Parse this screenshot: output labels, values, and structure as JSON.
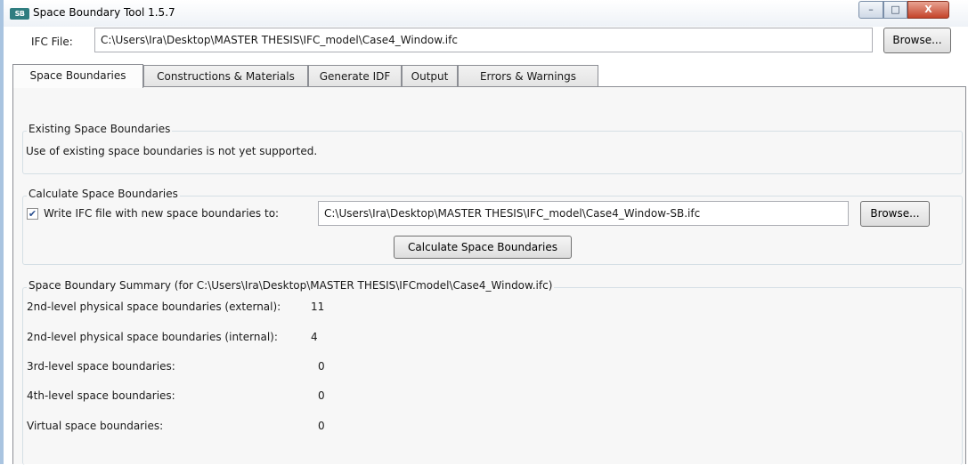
{
  "window": {
    "logo_text": "SB",
    "title": "Space Boundary Tool 1.5.7",
    "controls": {
      "minimize": "–",
      "maximize": "□",
      "close": "X"
    }
  },
  "file_row": {
    "label": "IFC File:",
    "path": "C:\\Users\\Ira\\Desktop\\MASTER THESIS\\IFC_model\\Case4_Window.ifc",
    "browse_label": "Browse..."
  },
  "tabs": [
    {
      "label": "Space Boundaries",
      "active": true
    },
    {
      "label": "Constructions & Materials",
      "active": false
    },
    {
      "label": "Generate IDF",
      "active": false
    },
    {
      "label": "Output",
      "active": false
    },
    {
      "label": "Errors & Warnings",
      "active": false
    }
  ],
  "existing": {
    "title": "Existing Space Boundaries",
    "message": "Use of existing space boundaries is not yet supported."
  },
  "calculate": {
    "title": "Calculate Space Boundaries",
    "checkbox_checked": true,
    "checkbox_label": "Write IFC file with new space boundaries to:",
    "output_path": "C:\\Users\\Ira\\Desktop\\MASTER THESIS\\IFC_model\\Case4_Window-SB.ifc",
    "browse_label": "Browse...",
    "calculate_button": "Calculate Space Boundaries"
  },
  "summary": {
    "title": "Space Boundary Summary (for C:\\Users\\Ira\\Desktop\\MASTER THESIS\\IFCmodel\\Case4_Window.ifc)",
    "rows": [
      {
        "label": "2nd-level physical space boundaries (external):",
        "value": "11"
      },
      {
        "label": "2nd-level physical space boundaries (internal):",
        "value": "4"
      },
      {
        "label": "3rd-level space boundaries:",
        "value": "0"
      },
      {
        "label": "4th-level space boundaries:",
        "value": "0"
      },
      {
        "label": "Virtual space boundaries:",
        "value": "0"
      }
    ]
  }
}
